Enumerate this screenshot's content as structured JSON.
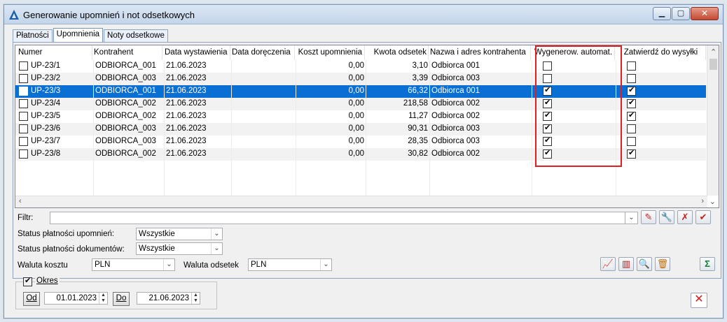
{
  "window": {
    "title": "Generowanie upomnień i not odsetkowych"
  },
  "tabs": [
    {
      "label": "Płatności"
    },
    {
      "label": "Upomnienia"
    },
    {
      "label": "Noty odsetkowe"
    }
  ],
  "grid": {
    "columns": {
      "numer": "Numer",
      "kontrahent": "Kontrahent",
      "data_wystawienia": "Data wystawienia",
      "data_doreczenia": "Data doręczenia",
      "koszt_upomnienia": "Koszt upomnienia",
      "kwota_odsetek": "Kwota odsetek",
      "nazwa_adres": "Nazwa i adres kontrahenta",
      "wygenerow": "Wygenerow. automat.",
      "zatwierdz": "Zatwierdź do wysyłki"
    },
    "rows": [
      {
        "numer": "UP-23/1",
        "kontrahent": "ODBIORCA_001",
        "data_wystawienia": "21.06.2023",
        "data_doreczenia": "",
        "koszt": "0,00",
        "kwota": "3,10",
        "nazwa": "Odbiorca 001",
        "wygenerow": false,
        "zatwierdz": false,
        "checked": false
      },
      {
        "numer": "UP-23/2",
        "kontrahent": "ODBIORCA_003",
        "data_wystawienia": "21.06.2023",
        "data_doreczenia": "",
        "koszt": "0,00",
        "kwota": "3,39",
        "nazwa": "Odbiorca 003",
        "wygenerow": false,
        "zatwierdz": false,
        "checked": false
      },
      {
        "numer": "UP-23/3",
        "kontrahent": "ODBIORCA_001",
        "data_wystawienia": "21.06.2023",
        "data_doreczenia": "",
        "koszt": "0,00",
        "kwota": "66,32",
        "nazwa": "Odbiorca 001",
        "wygenerow": true,
        "zatwierdz": true,
        "checked": false,
        "selected": true
      },
      {
        "numer": "UP-23/4",
        "kontrahent": "ODBIORCA_002",
        "data_wystawienia": "21.06.2023",
        "data_doreczenia": "",
        "koszt": "0,00",
        "kwota": "218,58",
        "nazwa": "Odbiorca 002",
        "wygenerow": true,
        "zatwierdz": true,
        "checked": false
      },
      {
        "numer": "UP-23/5",
        "kontrahent": "ODBIORCA_002",
        "data_wystawienia": "21.06.2023",
        "data_doreczenia": "",
        "koszt": "0,00",
        "kwota": "11,27",
        "nazwa": "Odbiorca 002",
        "wygenerow": true,
        "zatwierdz": true,
        "checked": false
      },
      {
        "numer": "UP-23/6",
        "kontrahent": "ODBIORCA_003",
        "data_wystawienia": "21.06.2023",
        "data_doreczenia": "",
        "koszt": "0,00",
        "kwota": "90,31",
        "nazwa": "Odbiorca 003",
        "wygenerow": true,
        "zatwierdz": false,
        "checked": false
      },
      {
        "numer": "UP-23/7",
        "kontrahent": "ODBIORCA_003",
        "data_wystawienia": "21.06.2023",
        "data_doreczenia": "",
        "koszt": "0,00",
        "kwota": "28,35",
        "nazwa": "Odbiorca 003",
        "wygenerow": true,
        "zatwierdz": false,
        "checked": false
      },
      {
        "numer": "UP-23/8",
        "kontrahent": "ODBIORCA_002",
        "data_wystawienia": "21.06.2023",
        "data_doreczenia": "",
        "koszt": "0,00",
        "kwota": "30,82",
        "nazwa": "Odbiorca 002",
        "wygenerow": true,
        "zatwierdz": true,
        "checked": false
      }
    ]
  },
  "filter": {
    "label": "Filtr:",
    "value": ""
  },
  "status_upomnien": {
    "label": "Status płatności upomnień:",
    "value": "Wszystkie"
  },
  "status_dokumentow": {
    "label": "Status płatności dokumentów:",
    "value": "Wszystkie"
  },
  "waluta_kosztu": {
    "label": "Waluta kosztu",
    "value": "PLN"
  },
  "waluta_odsetek": {
    "label": "Waluta odsetek",
    "value": "PLN"
  },
  "okres": {
    "label": "Okres",
    "checked": true,
    "od_label": "Od",
    "od_value": "01.01.2023",
    "do_label": "Do",
    "do_value": "21.06.2023"
  },
  "colors": {
    "selection": "#0a6fd3",
    "highlight_box": "#e02020"
  }
}
